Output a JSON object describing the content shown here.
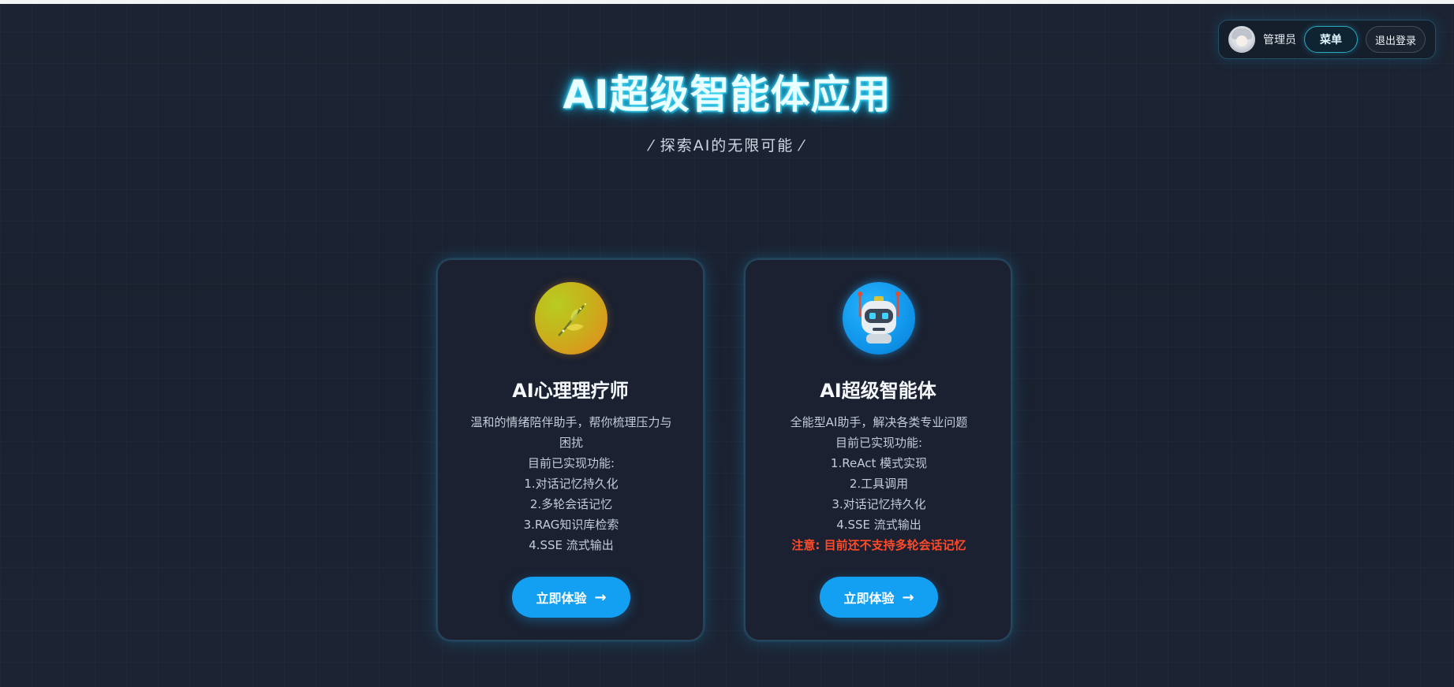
{
  "header": {
    "user_name": "管理员",
    "menu_label": "菜单",
    "logout_label": "退出登录"
  },
  "hero": {
    "title": "AI超级智能体应用",
    "subtitle": "⁄ 探索AI的无限可能 ⁄"
  },
  "cards": [
    {
      "icon": "leaf-icon",
      "title": "AI心理理疗师",
      "description_lines": [
        "温和的情绪陪伴助手，帮你梳理压力与",
        "困扰",
        "目前已实现功能:",
        "1.对话记忆持久化",
        "2.多轮会话记忆",
        "3.RAG知识库检索",
        "4.SSE 流式输出"
      ],
      "cta_label": "立即体验",
      "cta_arrow": "→"
    },
    {
      "icon": "robot-icon",
      "title": "AI超级智能体",
      "description_lines": [
        "全能型AI助手，解决各类专业问题",
        "目前已实现功能:",
        "1.ReAct 模式实现",
        "2.工具调用",
        "3.对话记忆持久化",
        "4.SSE 流式输出"
      ],
      "warning": "注意: 目前还不支持多轮会话记忆",
      "cta_label": "立即体验",
      "cta_arrow": "→"
    }
  ],
  "colors": {
    "background": "#1b2332",
    "accent_cyan": "#19c4f0",
    "button_blue": "#13a0f2",
    "warning_red": "#ff4a2a"
  }
}
